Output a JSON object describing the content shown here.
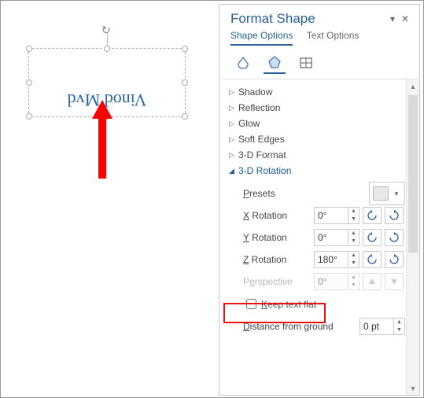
{
  "canvas": {
    "textbox_text": "Vinod Mvd"
  },
  "panel": {
    "title": "Format Shape",
    "tabs": {
      "shape_options": "Shape Options",
      "text_options": "Text Options"
    },
    "sections": {
      "shadow": "Shadow",
      "reflection": "Reflection",
      "glow": "Glow",
      "soft_edges": "Soft Edges",
      "format3d": "3-D Format",
      "rotation3d": "3-D Rotation"
    },
    "rotation": {
      "presets_label": "Presets",
      "x_label": "X Rotation",
      "y_label": "Y Rotation",
      "z_label": "Z Rotation",
      "perspective_label": "Perspective",
      "x_value": "0°",
      "y_value": "0°",
      "z_value": "180°",
      "perspective_value": "0°",
      "keep_flat": "Keep text flat",
      "distance_label": "Distance from ground",
      "distance_value": "0 pt"
    }
  }
}
